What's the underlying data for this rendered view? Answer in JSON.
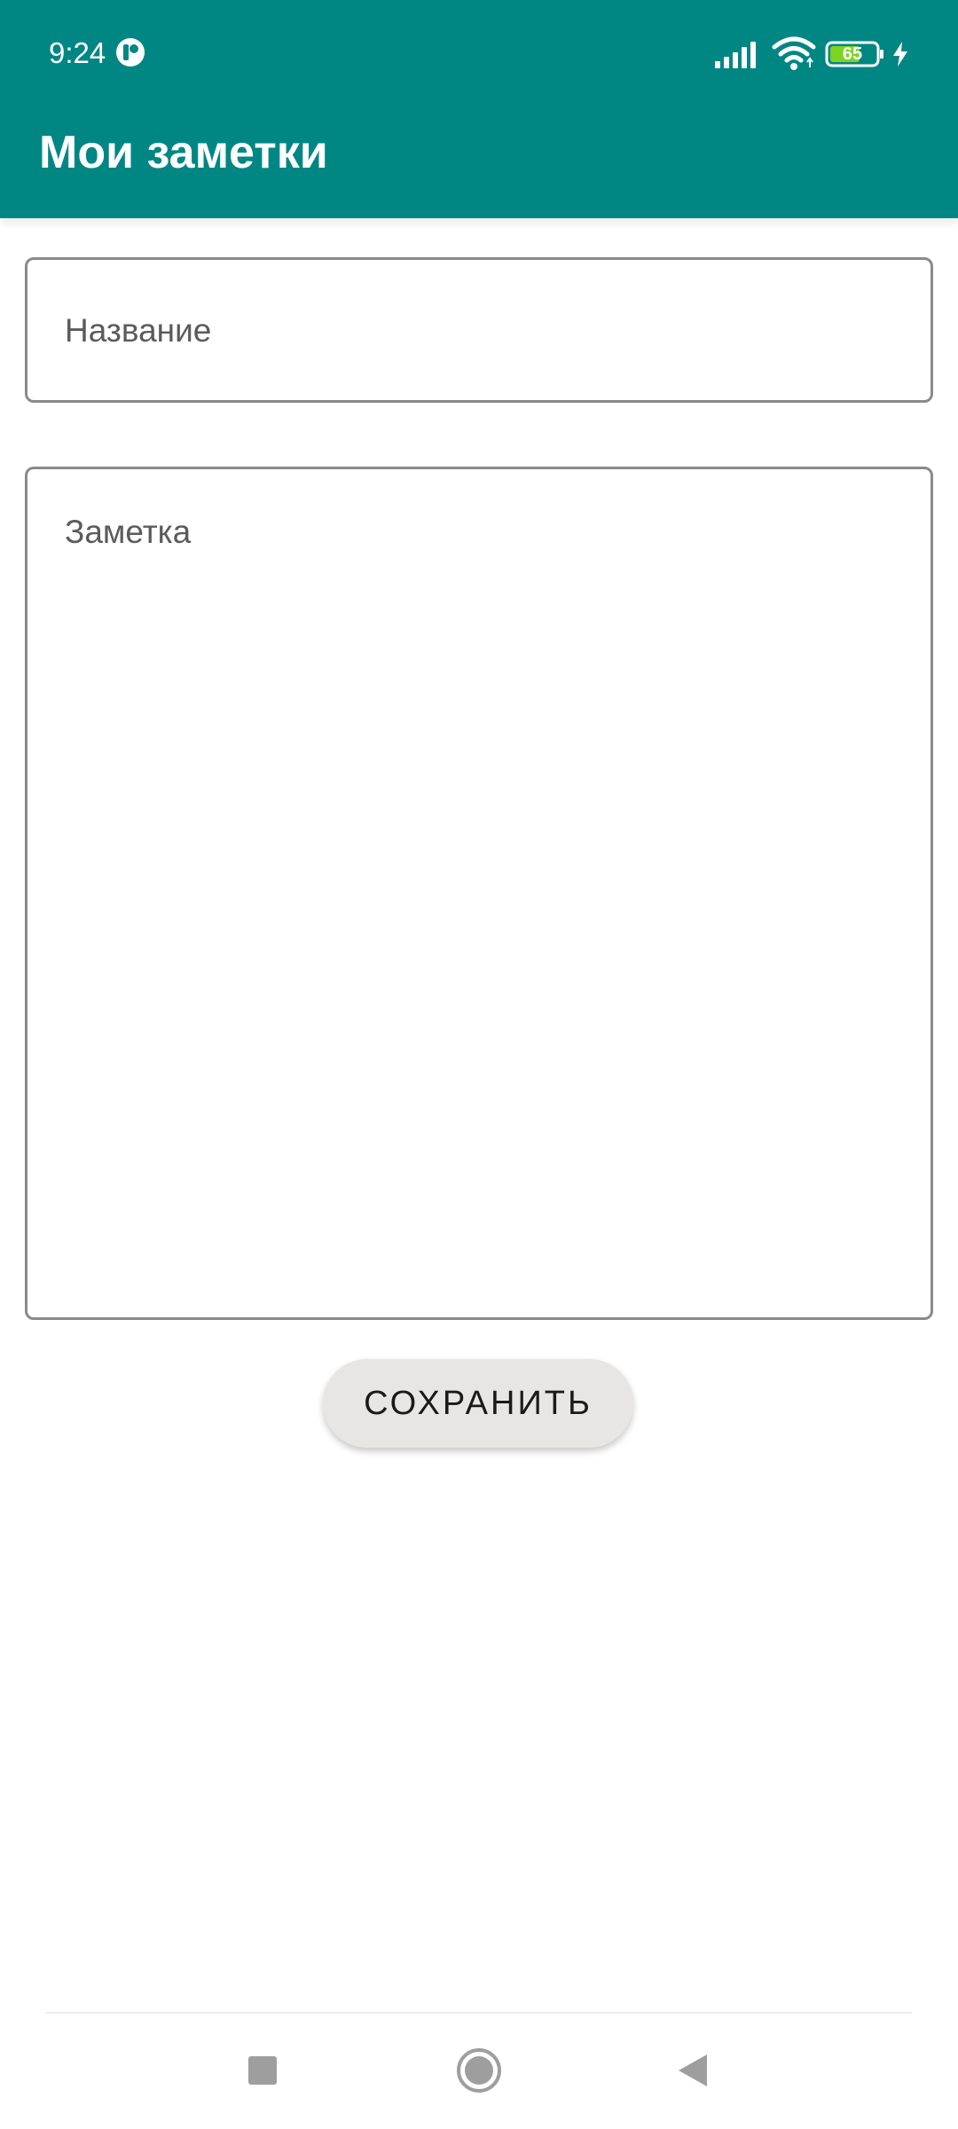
{
  "status_bar": {
    "time": "9:24",
    "battery_level": "65",
    "icons": [
      "app-notification-icon",
      "signal-icon",
      "wifi-icon",
      "battery-icon",
      "charging-icon"
    ]
  },
  "app_bar": {
    "title": "Мои заметки"
  },
  "form": {
    "title_placeholder": "Название",
    "title_value": "",
    "note_placeholder": "Заметка",
    "note_value": "",
    "save_label": "СОХРАНИТЬ"
  },
  "nav_bar": {
    "icons": [
      "recent-apps-icon",
      "home-icon",
      "back-icon"
    ]
  },
  "colors": {
    "primary": "#008784",
    "button_background": "#e8e6e4",
    "field_border": "#8a8a8a",
    "placeholder": "#5b5b5b"
  }
}
